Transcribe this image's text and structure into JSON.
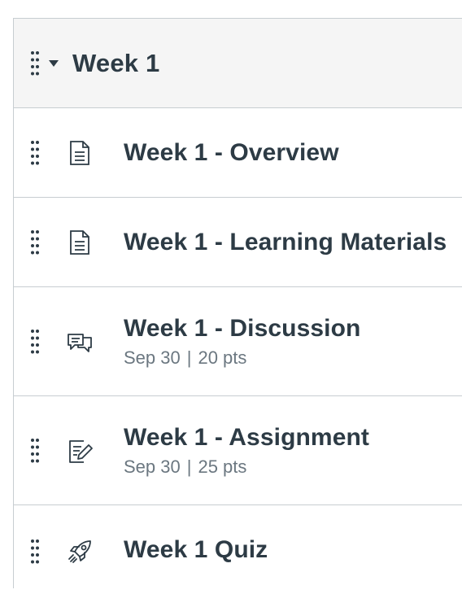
{
  "module": {
    "title": "Week 1",
    "items": [
      {
        "title": "Week 1 - Overview",
        "icon": "page-icon"
      },
      {
        "title": "Week 1 - Learning Materials",
        "icon": "page-icon"
      },
      {
        "title": "Week 1 - Discussion",
        "icon": "discussion-icon",
        "date": "Sep 30",
        "points": "20 pts",
        "separator": "|"
      },
      {
        "title": "Week 1 - Assignment",
        "icon": "assignment-icon",
        "date": "Sep 30",
        "points": "25 pts",
        "separator": "|"
      },
      {
        "title": "Week 1 Quiz",
        "icon": "quiz-icon"
      }
    ]
  },
  "colors": {
    "text": "#2d3b45",
    "muted": "#6b7780",
    "border": "#c7cdd1",
    "header_bg": "#f5f5f5"
  }
}
